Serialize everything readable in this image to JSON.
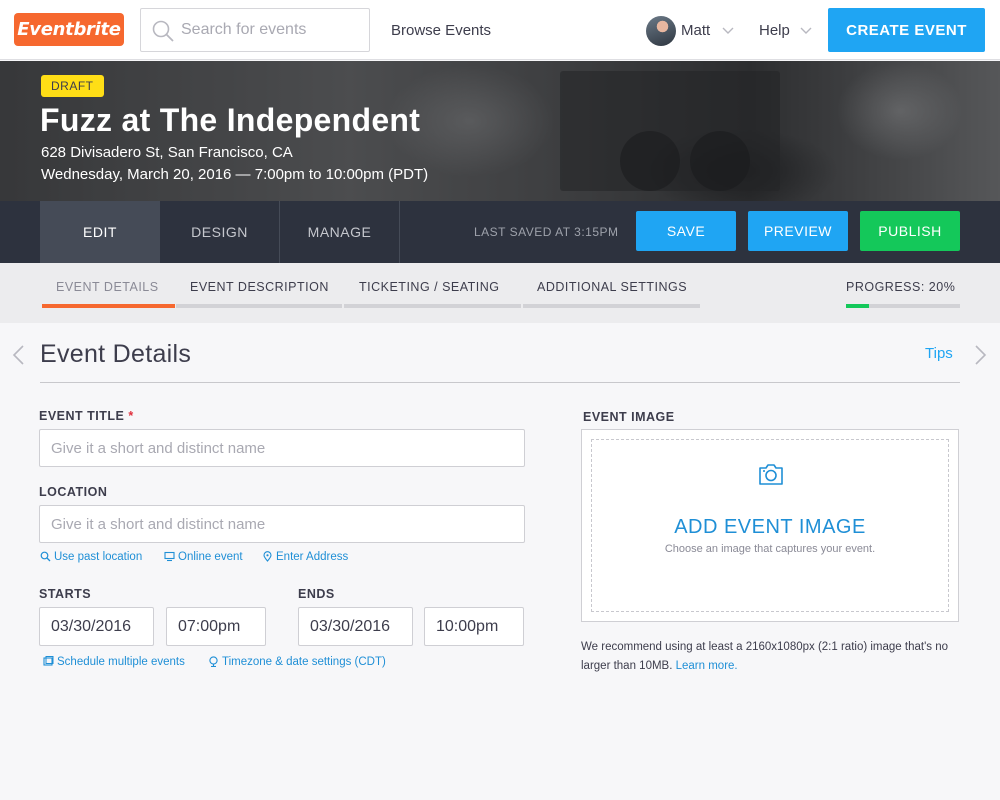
{
  "nav": {
    "logo": "Eventbrite",
    "search_placeholder": "Search for events",
    "browse": "Browse Events",
    "user": "Matt",
    "help": "Help",
    "create": "CREATE EVENT"
  },
  "event": {
    "status": "DRAFT",
    "title": "Fuzz at The Independent",
    "address": "628 Divisadero St, San Francisco, CA",
    "datetime": "Wednesday, March 20, 2016 — 7:00pm to 10:00pm (PDT)"
  },
  "actionbar": {
    "tabs": [
      "EDIT",
      "DESIGN",
      "MANAGE"
    ],
    "active_tab": "EDIT",
    "last_saved": "LAST SAVED AT 3:15PM",
    "save": "SAVE",
    "preview": "PREVIEW",
    "publish": "PUBLISH",
    "colors": {
      "save": "#1fa5f3",
      "preview": "#1fa5f3",
      "publish": "#14c85a"
    }
  },
  "subtabs": {
    "items": [
      "EVENT DETAILS",
      "EVENT DESCRIPTION",
      "TICKETING / SEATING",
      "ADDITIONAL SETTINGS"
    ],
    "active": "EVENT DETAILS",
    "progress_label": "PROGRESS: 20%",
    "progress": 0.2
  },
  "section": {
    "title": "Event Details",
    "tips": "Tips"
  },
  "form": {
    "title_label": "EVENT TITLE",
    "title_required": "*",
    "title_placeholder": "Give it a short and distinct name",
    "location_label": "LOCATION",
    "location_placeholder": "Give it a short and distinct name",
    "location_links": [
      "Use past location",
      "Online event",
      "Enter Address"
    ],
    "starts_label": "STARTS",
    "starts_date": "03/30/2016",
    "starts_time": "07:00pm",
    "ends_label": "ENDS",
    "ends_date": "03/30/2016",
    "ends_time": "10:00pm",
    "schedule_link": "Schedule multiple events",
    "timezone_link": "Timezone & date settings (CDT)"
  },
  "image": {
    "label": "EVENT IMAGE",
    "add": "ADD EVENT IMAGE",
    "sub": "Choose an image that captures your event.",
    "note": "We recommend using at least a 2160x1080px (2:1 ratio) image that's no larger than 10MB.",
    "learn_more": "Learn more."
  },
  "colors": {
    "accent": "#f6682f",
    "link": "#1fa5f3",
    "success": "#14c85a",
    "draft": "#ffde16"
  }
}
